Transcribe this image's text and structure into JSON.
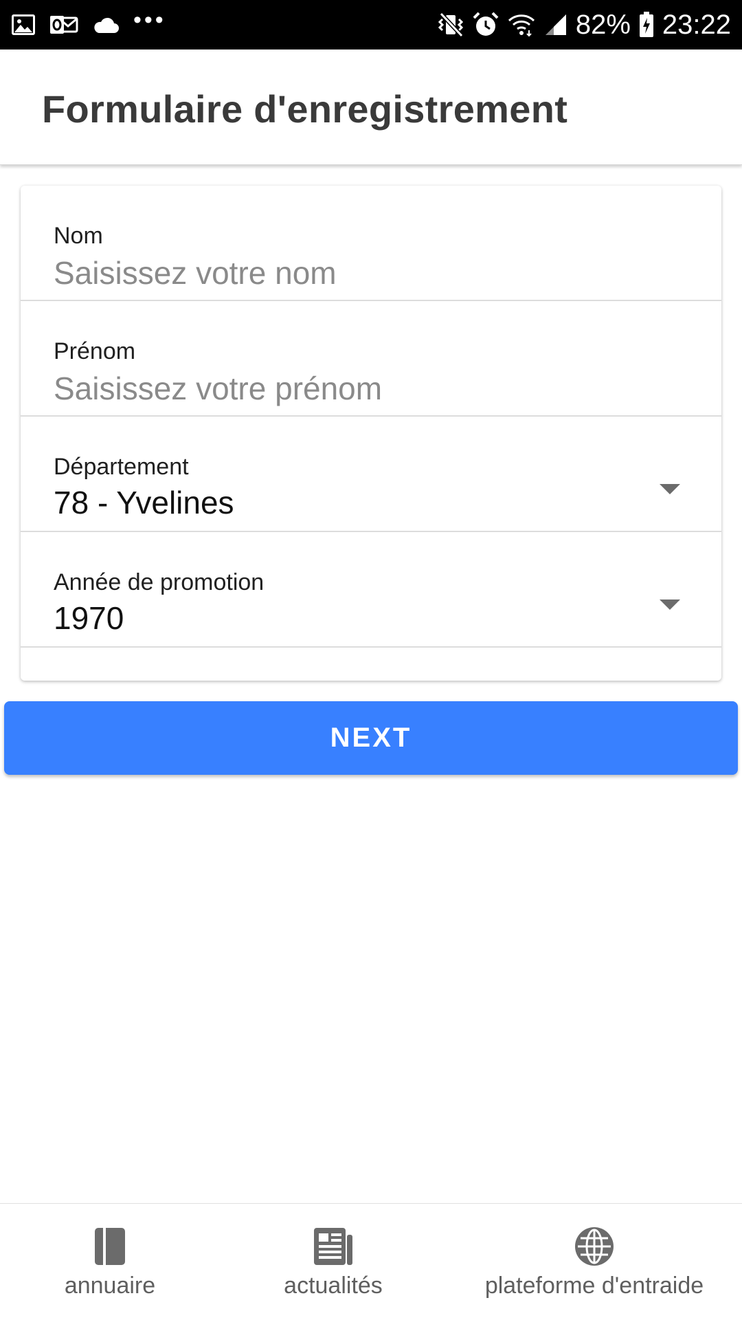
{
  "status_bar": {
    "left_icons": [
      "image-icon",
      "outlook-icon",
      "cloud-icon",
      "more-dots-icon"
    ],
    "right_icons": [
      "vibrate-icon",
      "alarm-icon",
      "wifi-icon",
      "signal-icon",
      "battery-charging-icon"
    ],
    "battery": "82%",
    "time": "23:22",
    "text_color": "#ffffff",
    "background": "#000000"
  },
  "header": {
    "title": "Formulaire d'enregistrement"
  },
  "form": {
    "fields": [
      {
        "label": "Nom",
        "placeholder": "Saisissez votre nom",
        "value": ""
      },
      {
        "label": "Prénom",
        "placeholder": "Saisissez votre prénom",
        "value": ""
      },
      {
        "label": "Département",
        "value": "78 - Yvelines",
        "icon": "caret-down-icon"
      },
      {
        "label": "Année de promotion",
        "value": "1970",
        "icon": "caret-down-icon"
      }
    ]
  },
  "next_button": {
    "label": "NEXT",
    "color": "#3880ff"
  },
  "tab_bar": {
    "tabs": [
      {
        "label": "annuaire",
        "icon": "book-icon"
      },
      {
        "label": "actualités",
        "icon": "newspaper-icon"
      },
      {
        "label": "plateforme d'entraide",
        "icon": "globe-icon"
      }
    ],
    "icon_color": "#6b6b6b"
  }
}
